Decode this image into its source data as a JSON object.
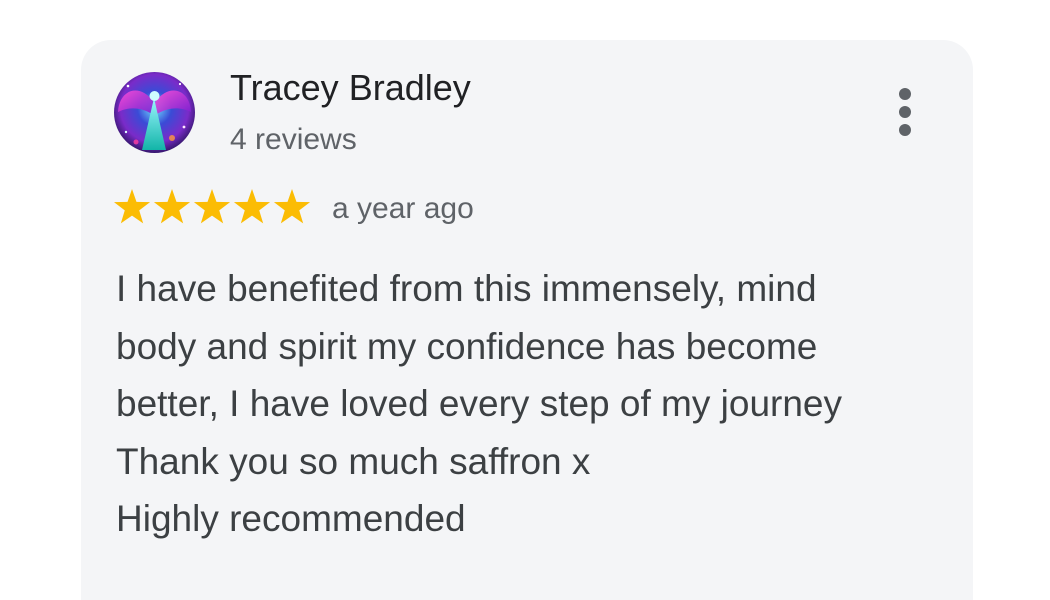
{
  "review": {
    "author": "Tracey Bradley",
    "review_count": "4 reviews",
    "rating": 5,
    "rating_max": 5,
    "time": "a year ago",
    "text_lines": [
      "I have benefited from this immensely, mind",
      "body and spirit my confidence has become",
      "better, I have loved every step of my journey",
      "Thank you so much saffron x",
      "Highly recommended"
    ],
    "avatar_icon": "cosmic-angel-avatar",
    "menu_icon": "more-vert-icon",
    "star_icon": "star-icon"
  },
  "colors": {
    "star": "#fbbc04",
    "card_background": "#f4f5f7",
    "name_text": "#202124",
    "meta_text": "#5f6368",
    "body_text": "#3c4043"
  }
}
